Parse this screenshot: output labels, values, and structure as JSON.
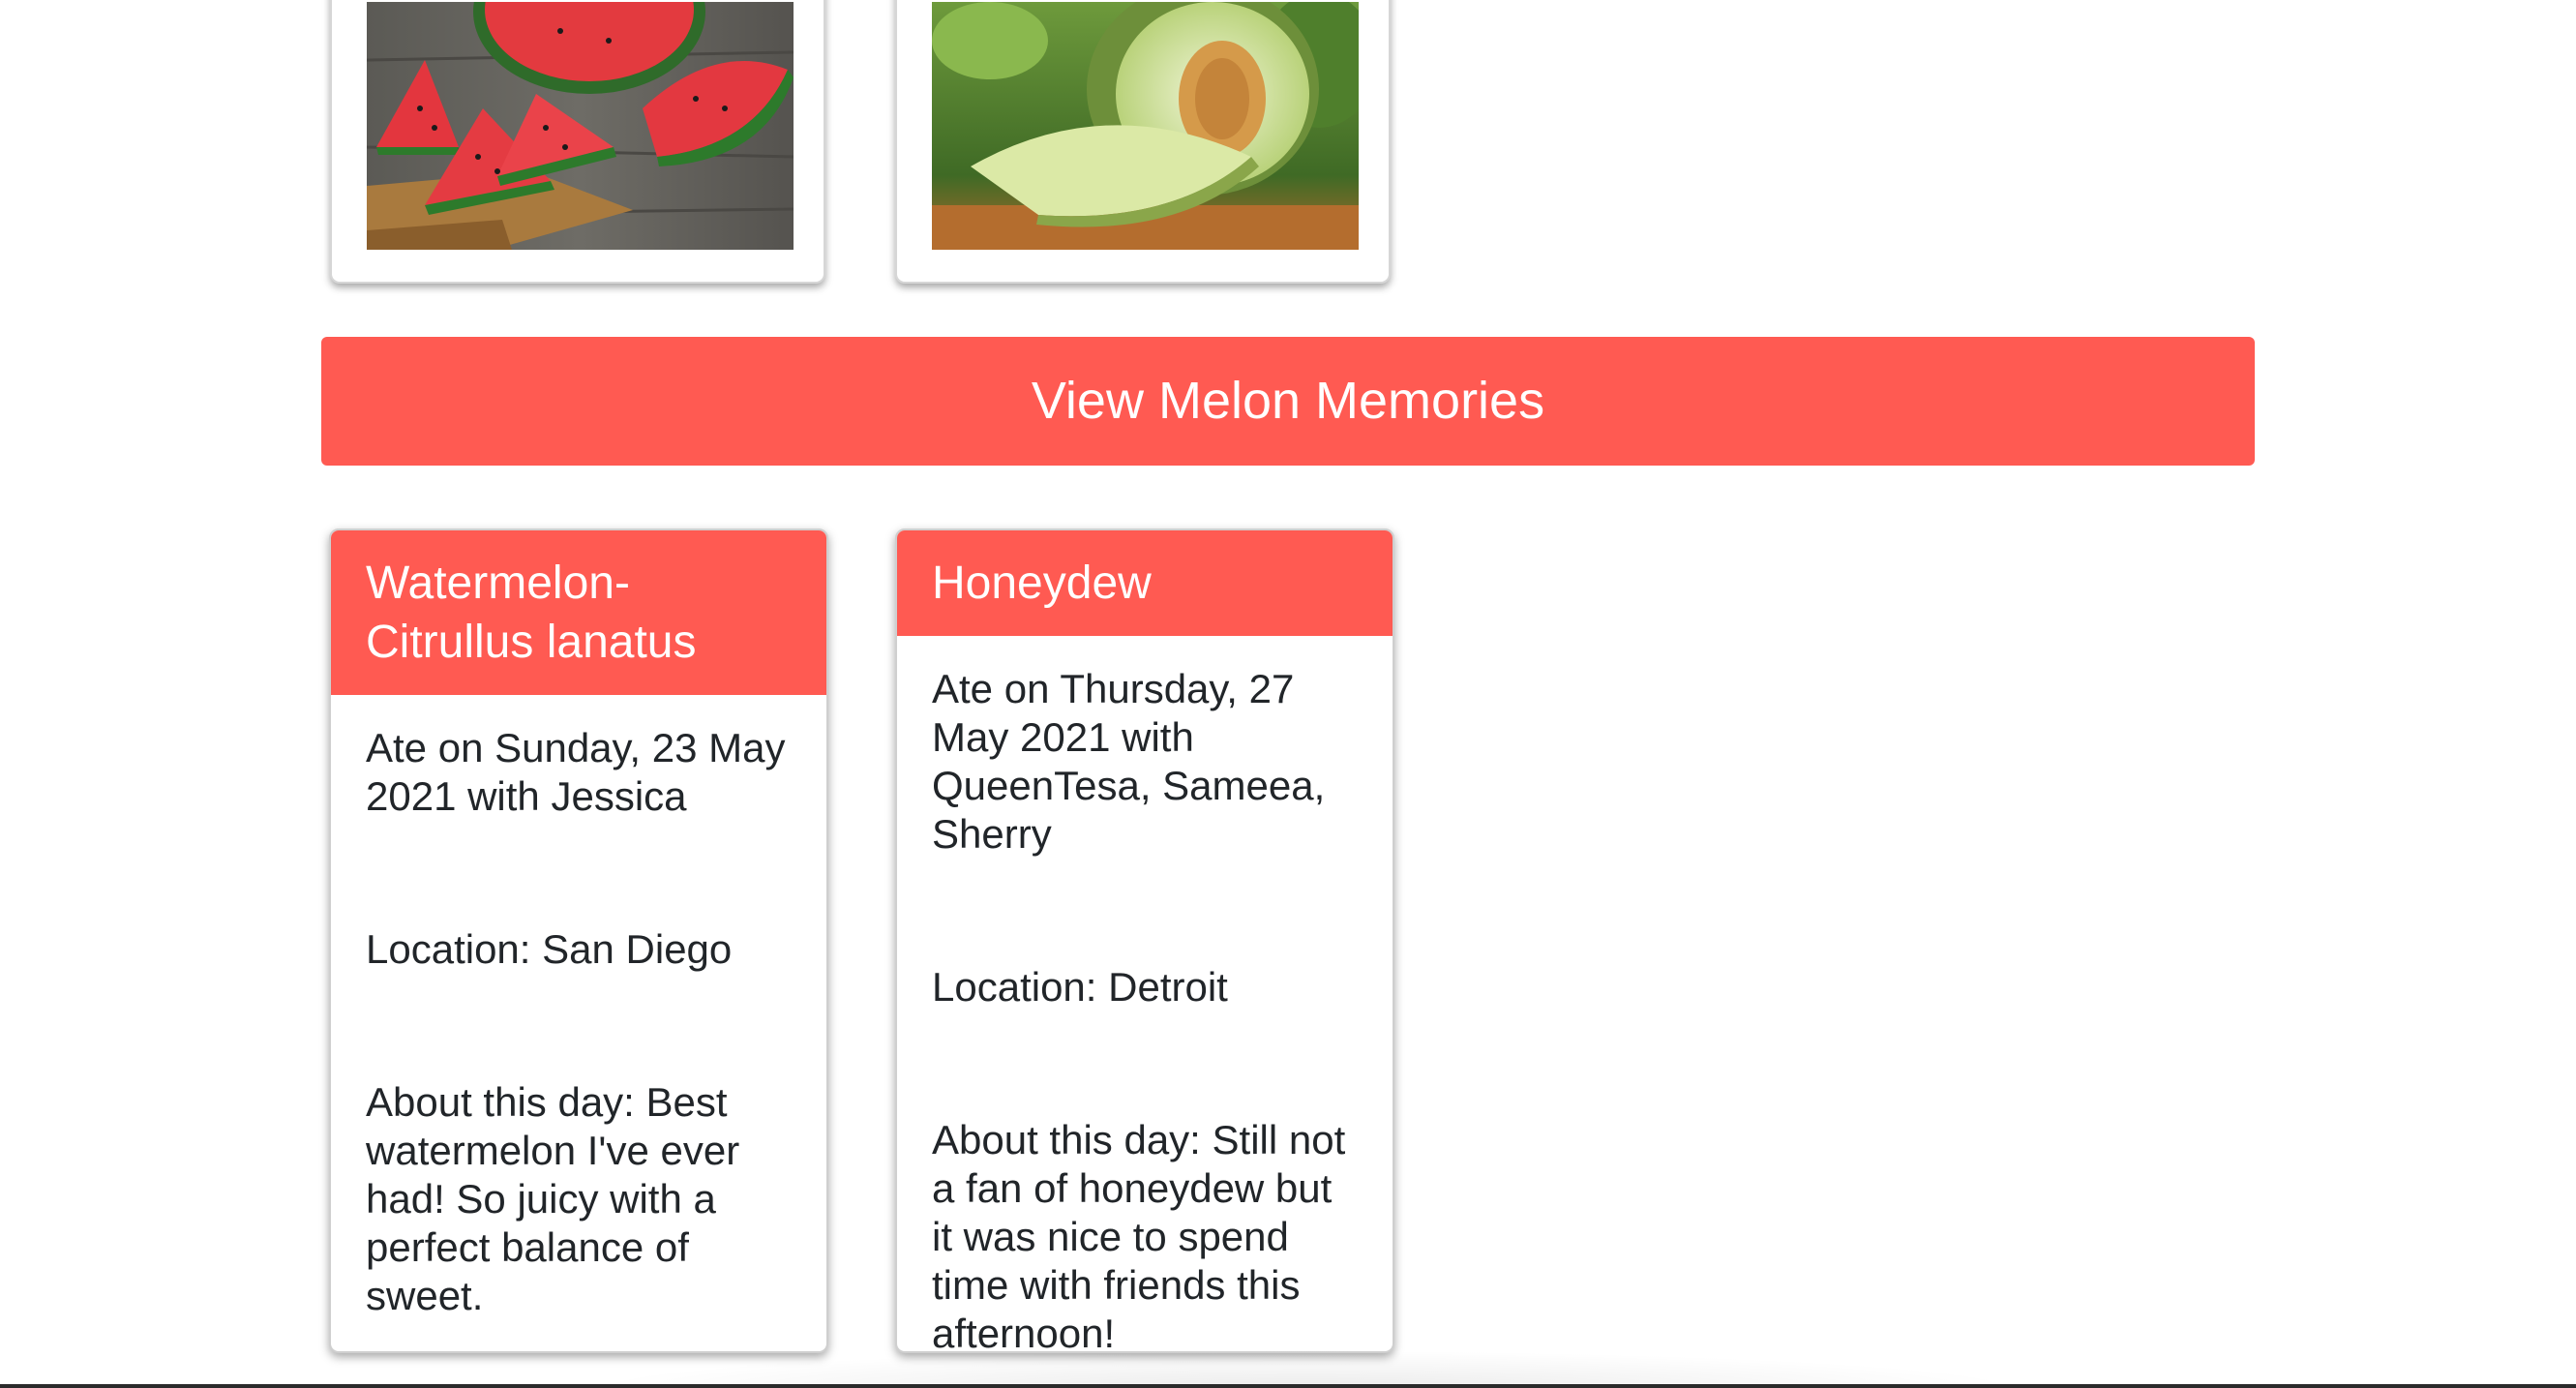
{
  "photos": [
    {
      "name": "watermelon-photo",
      "alt": "Watermelon"
    },
    {
      "name": "honeydew-photo",
      "alt": "Honeydew"
    }
  ],
  "button": {
    "label": "View Melon Memories"
  },
  "cards": [
    {
      "title": "Watermelon-Citrullus lanatus",
      "ate": "Ate on Sunday, 23 May 2021 with Jessica",
      "location": "Location: San Diego",
      "about": "About this day: Best watermelon I've ever had! So juicy with a perfect balance of sweet."
    },
    {
      "title": "Honeydew",
      "ate": "Ate on Thursday, 27 May 2021 with QueenTesa, Sameea, Sherry",
      "location": "Location: Detroit",
      "about": "About this day: Still not a fan of honeydew but it was nice to spend time with friends this afternoon!"
    }
  ],
  "colors": {
    "accent": "#ff5a52",
    "text": "#212529",
    "background": "#ffffff"
  }
}
